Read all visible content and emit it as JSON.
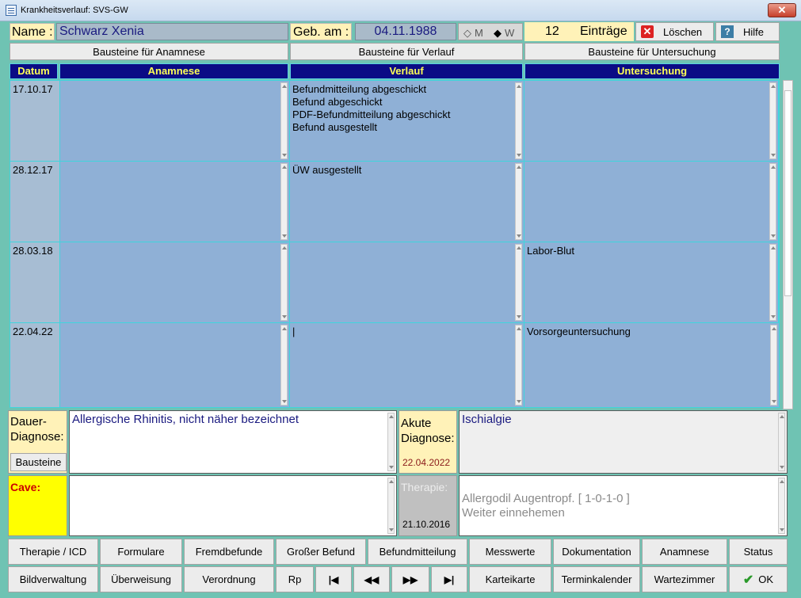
{
  "window": {
    "title": "Krankheitsverlauf:  SVS-GW",
    "close_label": "✕"
  },
  "header": {
    "name_label": "Name :",
    "name_value": "Schwarz Xenia",
    "geb_label": "Geb. am :",
    "geb_value": "04.11.1988",
    "gender_m": "M",
    "gender_w": "W",
    "entries_count": "12",
    "entries_label": "Einträge",
    "loeschen_label": "Löschen",
    "hilfe_label": "Hilfe"
  },
  "bausteine": {
    "anamnese": "Bausteine für Anamnese",
    "verlauf": "Bausteine für Verlauf",
    "untersuchung": "Bausteine für Untersuchung"
  },
  "columns": {
    "datum": "Datum",
    "anamnese": "Anamnese",
    "verlauf": "Verlauf",
    "untersuchung": "Untersuchung"
  },
  "rows": [
    {
      "datum": "17.10.17",
      "anamnese": "",
      "verlauf": "Befundmitteilung abgeschickt\nBefund abgeschickt\nPDF-Befundmitteilung abgeschickt\nBefund ausgestellt",
      "untersuchung": ""
    },
    {
      "datum": "28.12.17",
      "anamnese": "",
      "verlauf": "ÜW ausgestellt",
      "untersuchung": ""
    },
    {
      "datum": "28.03.18",
      "anamnese": "",
      "verlauf": "",
      "untersuchung": "Labor-Blut"
    },
    {
      "datum": "22.04.22",
      "anamnese": "",
      "verlauf": "|",
      "untersuchung": "Vorsorgeuntersuchung"
    }
  ],
  "diagnose": {
    "dauer_label": "Dauer-\nDiagnose:",
    "dauer_value": "Allergische Rhinitis, nicht näher bezeichnet",
    "bausteine_btn": "Bausteine",
    "akute_label": "Akute\nDiagnose:",
    "akute_date": "22.04.2022",
    "akute_value": "Ischialgie",
    "cave_label": "Cave:",
    "cave_value": "",
    "therapie_label": "Therapie:",
    "therapie_date": "21.10.2016",
    "therapie_value": "Allergodil Augentropf. [ 1-0-1-0 ]\nWeiter einnehemen"
  },
  "buttons_row1": [
    "Therapie / ICD",
    "Formulare",
    "Fremdbefunde",
    "Großer Befund",
    "Befundmitteilung",
    "Messwerte",
    "Dokumentation",
    "Anamnese",
    "Status"
  ],
  "buttons_row2": {
    "bildverwaltung": "Bildverwaltung",
    "ueberweisung": "Überweisung",
    "verordnung": "Verordnung",
    "rp": "Rp",
    "nav_first": "|◀",
    "nav_prev": "◀◀",
    "nav_next": "▶▶",
    "nav_last": "▶|",
    "karteikarte": "Karteikarte",
    "terminkalender": "Terminkalender",
    "wartezimmer": "Wartezimmer",
    "ok": "OK"
  }
}
